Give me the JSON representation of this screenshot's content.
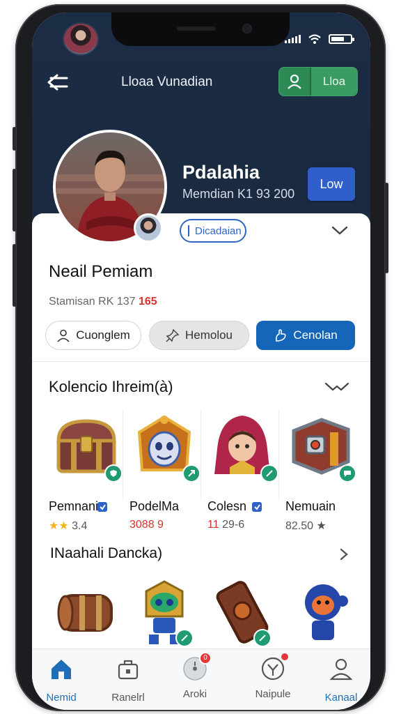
{
  "status_bar": {
    "icons": [
      "signal-icon",
      "wifi-icon",
      "battery-icon"
    ],
    "battery_level": 0.7
  },
  "header": {
    "title": "Lloaa Vunadian",
    "action_label": "Lloa"
  },
  "profile_hero": {
    "name": "Pdalahia",
    "subtitle": "Memdian K1 93 200",
    "button_label": "Low"
  },
  "profile": {
    "chip_label": "Dicadaian",
    "name": "Neail Pemiam",
    "meta_text": "Stamisan RK 137",
    "meta_accent": "165"
  },
  "actions": {
    "primary_outline": "Cuonglem",
    "secondary": "Hemolou",
    "primary": "Cenolan"
  },
  "collection": {
    "title": "Kolencio Ihreim(à)",
    "items": [
      {
        "name": "Pemnani",
        "stars": "★★",
        "stat": "3.4"
      },
      {
        "name": "PodelMa",
        "stat": "3088 9",
        "stat_red": true
      },
      {
        "name": "Colesn",
        "stat_prefix": "11",
        "stat": "29-6"
      },
      {
        "name": "Nemuain",
        "stat": "82.50 ★"
      }
    ]
  },
  "section2": {
    "title": "INaahali Dancka)"
  },
  "tabbar": {
    "tabs": [
      {
        "label": "Nemid",
        "icon": "home-icon",
        "active": true
      },
      {
        "label": "Ranelrl",
        "icon": "briefcase-icon"
      },
      {
        "label": "Aroki",
        "icon": "target-icon",
        "badge": "0"
      },
      {
        "label": "Naipule",
        "icon": "compass-icon"
      },
      {
        "label": "Kanaal",
        "icon": "user-icon"
      }
    ]
  },
  "colors": {
    "header_bg": "#1b2c45",
    "accent_blue": "#1566b8",
    "accent_green": "#2e8a55",
    "accent_red": "#d8332b"
  }
}
